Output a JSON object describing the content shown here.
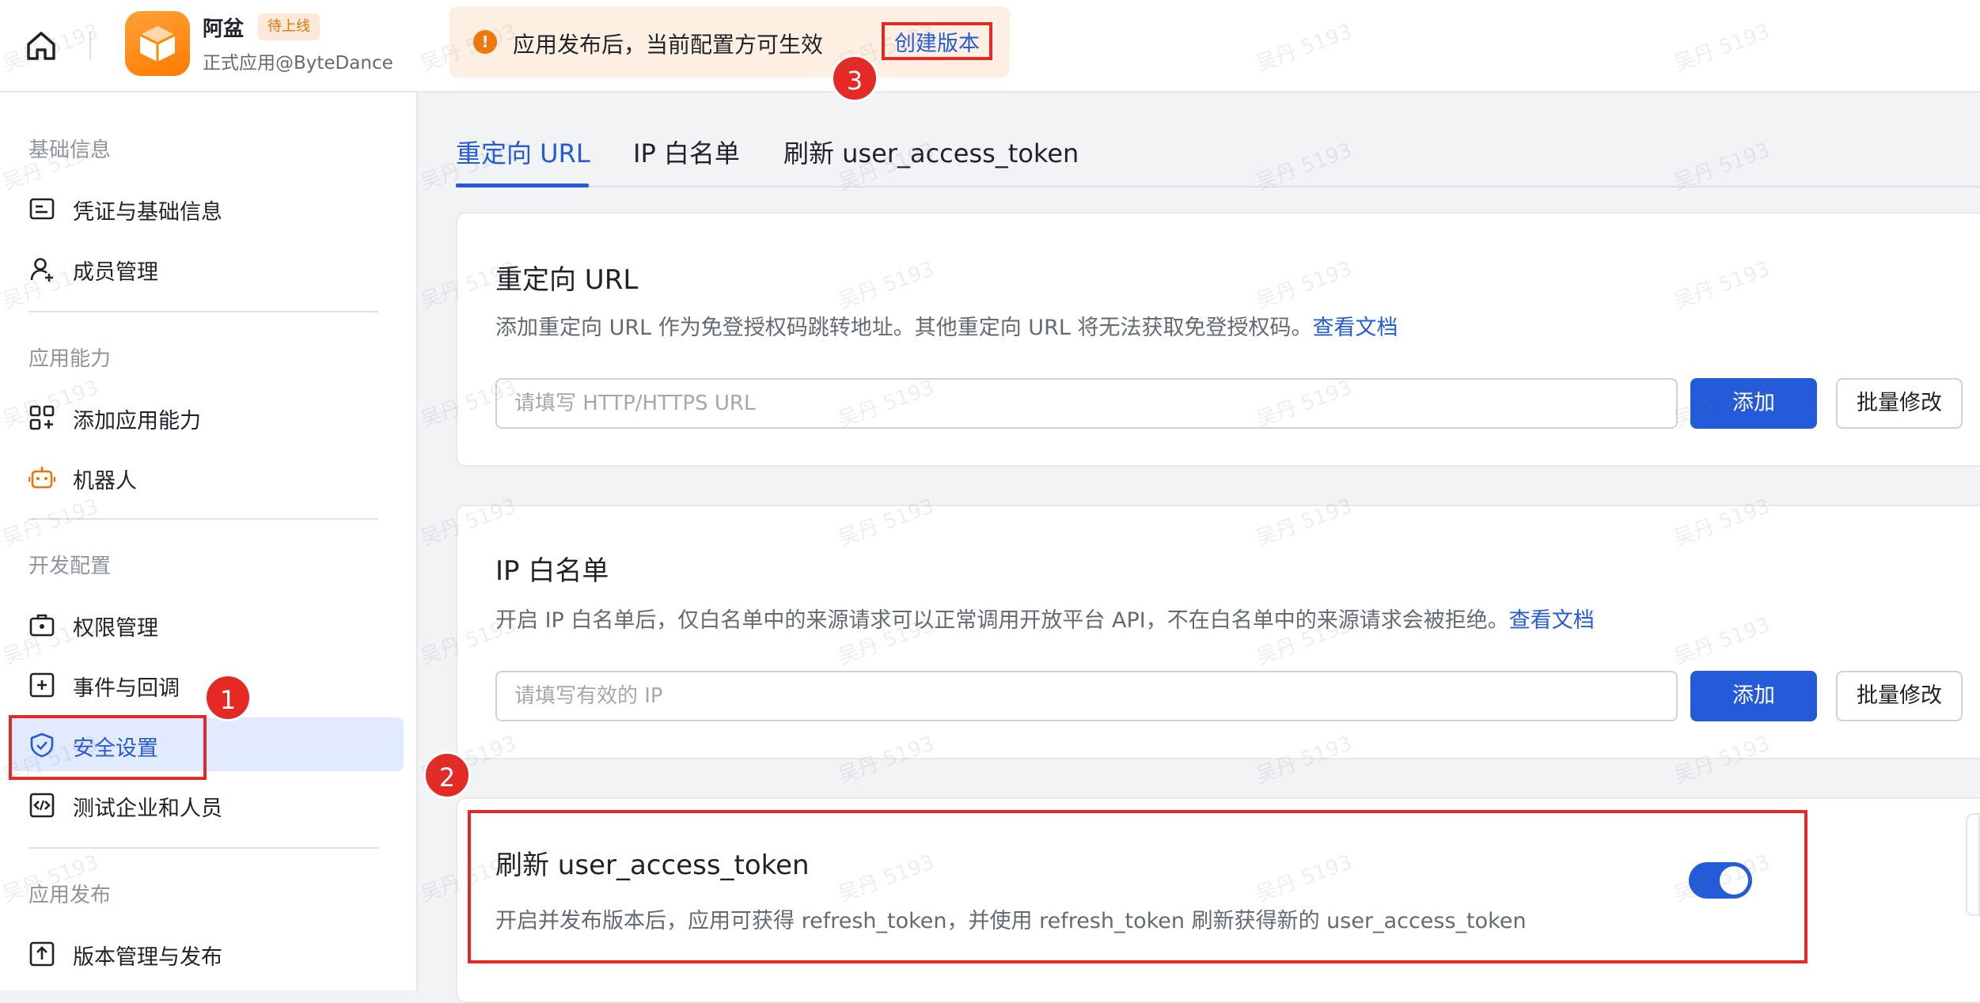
{
  "header": {
    "app_name": "阿盆",
    "status": "待上线",
    "org": "正式应用@ByteDance",
    "notice": "应用发布后，当前配置方可生效",
    "create_version": "创建版本",
    "step_marker": "3"
  },
  "sidebar": {
    "sections": [
      {
        "title": "基础信息",
        "items": [
          {
            "label": "凭证与基础信息",
            "icon": "credential-icon"
          },
          {
            "label": "成员管理",
            "icon": "member-icon"
          }
        ]
      },
      {
        "title": "应用能力",
        "items": [
          {
            "label": "添加应用能力",
            "icon": "app-capability-icon"
          },
          {
            "label": "机器人",
            "icon": "robot-icon"
          }
        ]
      },
      {
        "title": "开发配置",
        "items": [
          {
            "label": "权限管理",
            "icon": "permission-icon"
          },
          {
            "label": "事件与回调",
            "icon": "event-icon"
          },
          {
            "label": "安全设置",
            "icon": "shield-icon",
            "active": true
          },
          {
            "label": "测试企业和人员",
            "icon": "code-icon"
          }
        ]
      },
      {
        "title": "应用发布",
        "items": [
          {
            "label": "版本管理与发布",
            "icon": "upload-icon"
          }
        ]
      }
    ],
    "step_marker": "1"
  },
  "tabs": [
    {
      "label": "重定向 URL",
      "active": true
    },
    {
      "label": "IP 白名单",
      "active": false
    },
    {
      "label": "刷新 user_access_token",
      "active": false
    }
  ],
  "redirect_card": {
    "title": "重定向 URL",
    "desc": "添加重定向 URL 作为免登授权码跳转地址。其他重定向 URL 将无法获取免登授权码。",
    "doc_link": "查看文档",
    "placeholder": "请填写 HTTP/HTTPS URL",
    "add_label": "添加",
    "batch_label": "批量修改"
  },
  "ip_card": {
    "title": "IP 白名单",
    "desc": "开启 IP 白名单后，仅白名单中的来源请求可以正常调用开放平台 API，不在白名单中的来源请求会被拒绝。",
    "doc_link": "查看文档",
    "placeholder": "请填写有效的 IP",
    "add_label": "添加",
    "batch_label": "批量修改"
  },
  "token_card": {
    "title": "刷新 user_access_token",
    "desc": "开启并发布版本后，应用可获得 refresh_token，并使用 refresh_token 刷新获得新的 user_access_token",
    "enabled": true,
    "step_marker": "2"
  },
  "watermark": "吴丹 5193",
  "colors": {
    "accent": "#245bdb",
    "highlight": "#e52a26",
    "app_logo": "#ff8a00",
    "warning": "#f2780a"
  }
}
